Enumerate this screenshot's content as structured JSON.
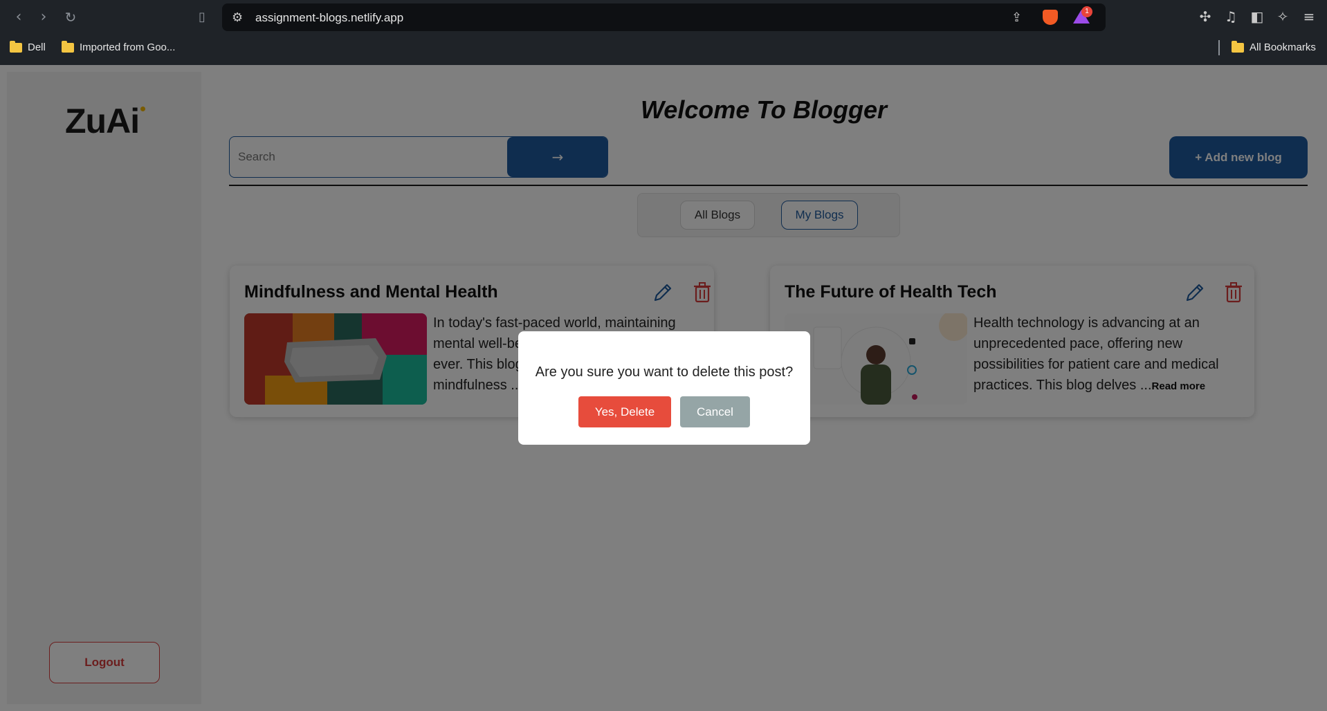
{
  "browser": {
    "url": "assignment-blogs.netlify.app",
    "shield_badge": "1",
    "bookmarks": [
      "Dell",
      "Imported from Goo..."
    ],
    "all_bookmarks": "All Bookmarks"
  },
  "sidebar": {
    "logo": "ZuAi",
    "logout_label": "Logout"
  },
  "header": {
    "title": "Welcome To Blogger",
    "search_placeholder": "Search",
    "search_button_icon": "→",
    "add_button_label": "+ Add new blog"
  },
  "tabs": {
    "all": "All Blogs",
    "mine": "My Blogs"
  },
  "posts": [
    {
      "title": "Mindfulness and Mental Health",
      "excerpt": "In today's fast-paced world, maintaining mental well-being is more important than ever. This blog explores the practice of mindfulness ..."
    },
    {
      "title": "The Future of Health Tech",
      "excerpt": "Health technology is advancing at an unprecedented pace, offering new possibilities for patient care and medical practices. This blog delves ...",
      "read_more": "Read more"
    }
  ],
  "dialog": {
    "message": "Are you sure you want to delete this post?",
    "confirm_label": "Yes, Delete",
    "cancel_label": "Cancel"
  },
  "colors": {
    "primary": "#1e5a9e",
    "danger": "#e74c3c",
    "cancel": "#95a5a6"
  }
}
